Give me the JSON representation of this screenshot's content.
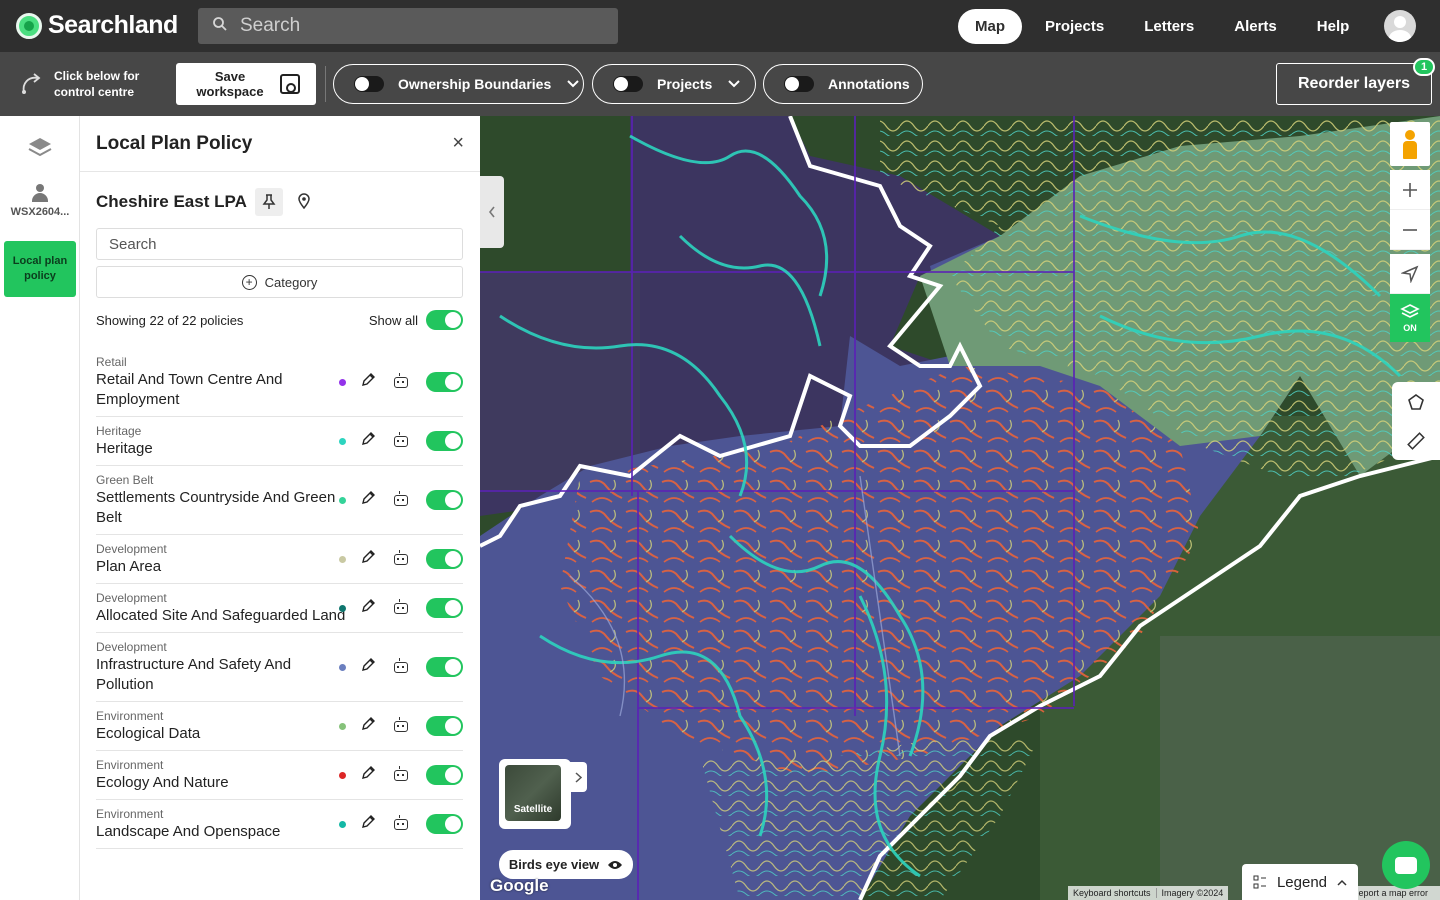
{
  "app": {
    "brand": "Searchland",
    "search_placeholder": "Search",
    "nav": [
      {
        "label": "Map",
        "active": true
      },
      {
        "label": "Projects",
        "active": false
      },
      {
        "label": "Letters",
        "active": false
      },
      {
        "label": "Alerts",
        "active": false
      },
      {
        "label": "Help",
        "active": false
      }
    ]
  },
  "toolbar": {
    "control_centre": "Click below for control centre",
    "save_workspace": "Save workspace",
    "pills": [
      {
        "label": "Ownership Boundaries",
        "dropdown": true,
        "on": false
      },
      {
        "label": "Projects",
        "dropdown": true,
        "on": false
      },
      {
        "label": "Annotations",
        "dropdown": false,
        "on": false
      }
    ],
    "reorder_layers": "Reorder layers",
    "reorder_badge": "1"
  },
  "rail": {
    "user_label": "WSX2604...",
    "active_label": "Local plan policy"
  },
  "panel": {
    "title": "Local Plan Policy",
    "close_glyph": "×",
    "lpa_name": "Cheshire East LPA",
    "search_placeholder": "Search",
    "category_label": "Category",
    "showing": "Showing 22 of 22 policies",
    "show_all": "Show all",
    "policies": [
      {
        "category": "Retail",
        "name": "Retail And Town Centre And Employment",
        "color": "#9333ea"
      },
      {
        "category": "Heritage",
        "name": "Heritage",
        "color": "#2dd4bf"
      },
      {
        "category": "Green Belt",
        "name": "Settlements Countryside And Green Belt",
        "color": "#34d399"
      },
      {
        "category": "Development",
        "name": "Plan Area",
        "color": "#c9c9a3"
      },
      {
        "category": "Development",
        "name": "Allocated Site And Safeguarded Land",
        "color": "#0f766e"
      },
      {
        "category": "Development",
        "name": "Infrastructure And Safety And Pollution",
        "color": "#6b7fbf"
      },
      {
        "category": "Environment",
        "name": "Ecological Data",
        "color": "#86c27a"
      },
      {
        "category": "Environment",
        "name": "Ecology And Nature",
        "color": "#dc2626"
      },
      {
        "category": "Environment",
        "name": "Landscape And Openspace",
        "color": "#14b8a6"
      }
    ]
  },
  "map": {
    "layers_on_label": "ON",
    "satellite_label": "Satellite",
    "birds_eye": "Birds eye view",
    "google": "Google",
    "attribution": [
      "Keyboard shortcuts",
      "Imagery ©2024"
    ],
    "legend": "Legend",
    "report": "Report a map error"
  }
}
